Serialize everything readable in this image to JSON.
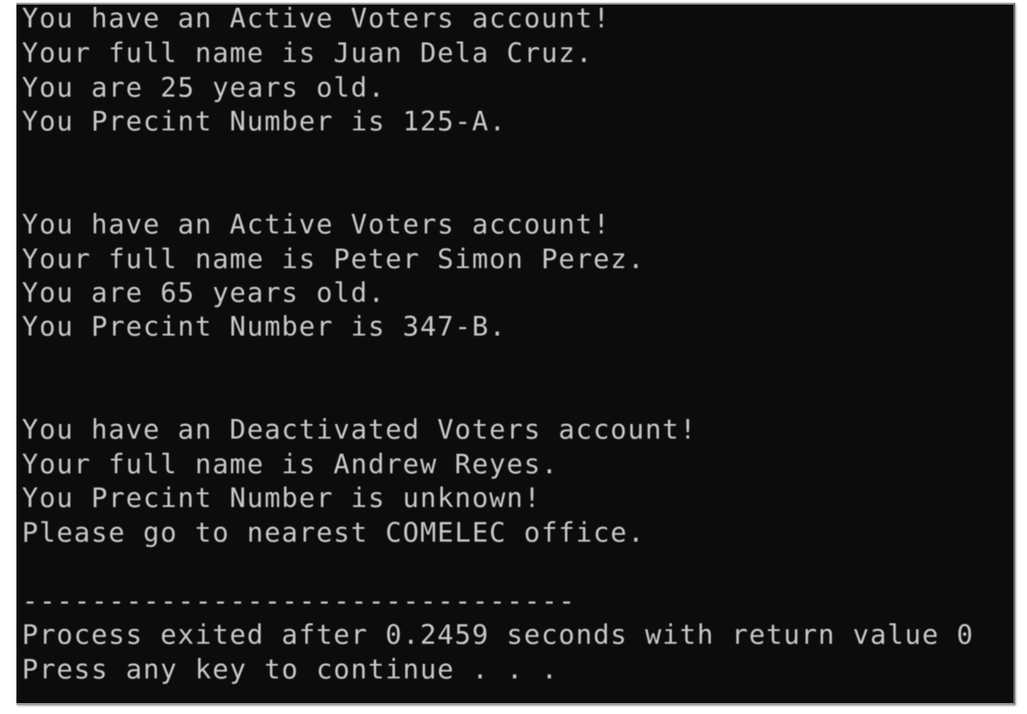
{
  "console": {
    "lines": [
      "You have an Active Voters account!",
      "Your full name is Juan Dela Cruz.",
      "You are 25 years old.",
      "You Precint Number is 125-A.",
      "",
      "",
      "You have an Active Voters account!",
      "Your full name is Peter Simon Perez.",
      "You are 65 years old.",
      "You Precint Number is 347-B.",
      "",
      "",
      "You have an Deactivated Voters account!",
      "Your full name is Andrew Reyes.",
      "You Precint Number is unknown!",
      "Please go to nearest COMELEC office.",
      "",
      "--------------------------------",
      "Process exited after 0.2459 seconds with return value 0",
      "Press any key to continue . . ."
    ]
  }
}
